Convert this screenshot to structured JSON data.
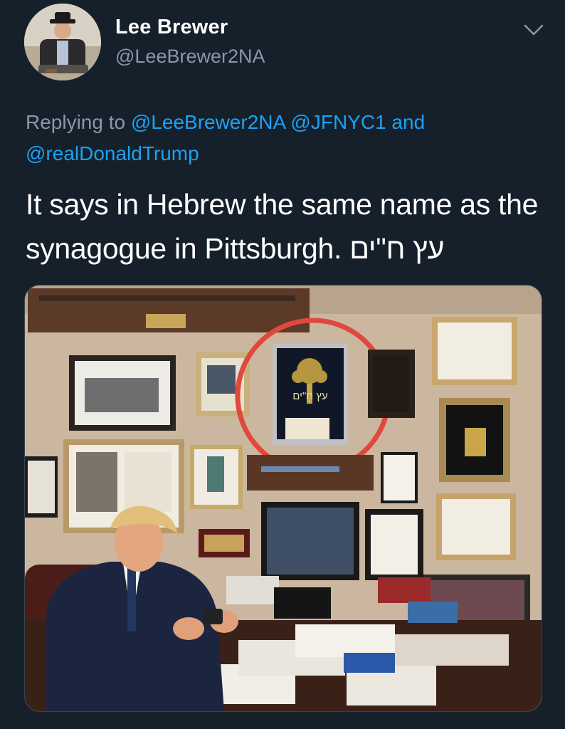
{
  "author": {
    "display_name": "Lee Brewer",
    "handle": "@LeeBrewer2NA"
  },
  "reply": {
    "prefix": "Replying to",
    "mention_1": "@LeeBrewer2NA",
    "mention_2": "@JFNYC1",
    "conjunction": "and",
    "mention_3": "@realDonaldTrump"
  },
  "tweet": {
    "text": "It says in Hebrew the same name as the synagogue in Pittsburgh.",
    "hebrew": "עץ ח\"ים"
  },
  "media": {
    "frame_hebrew": "עץ ח\"ים",
    "highlight_color": "#e0483e"
  },
  "colors": {
    "background": "#15202b",
    "link": "#1da1f2",
    "muted": "#8899a6"
  }
}
